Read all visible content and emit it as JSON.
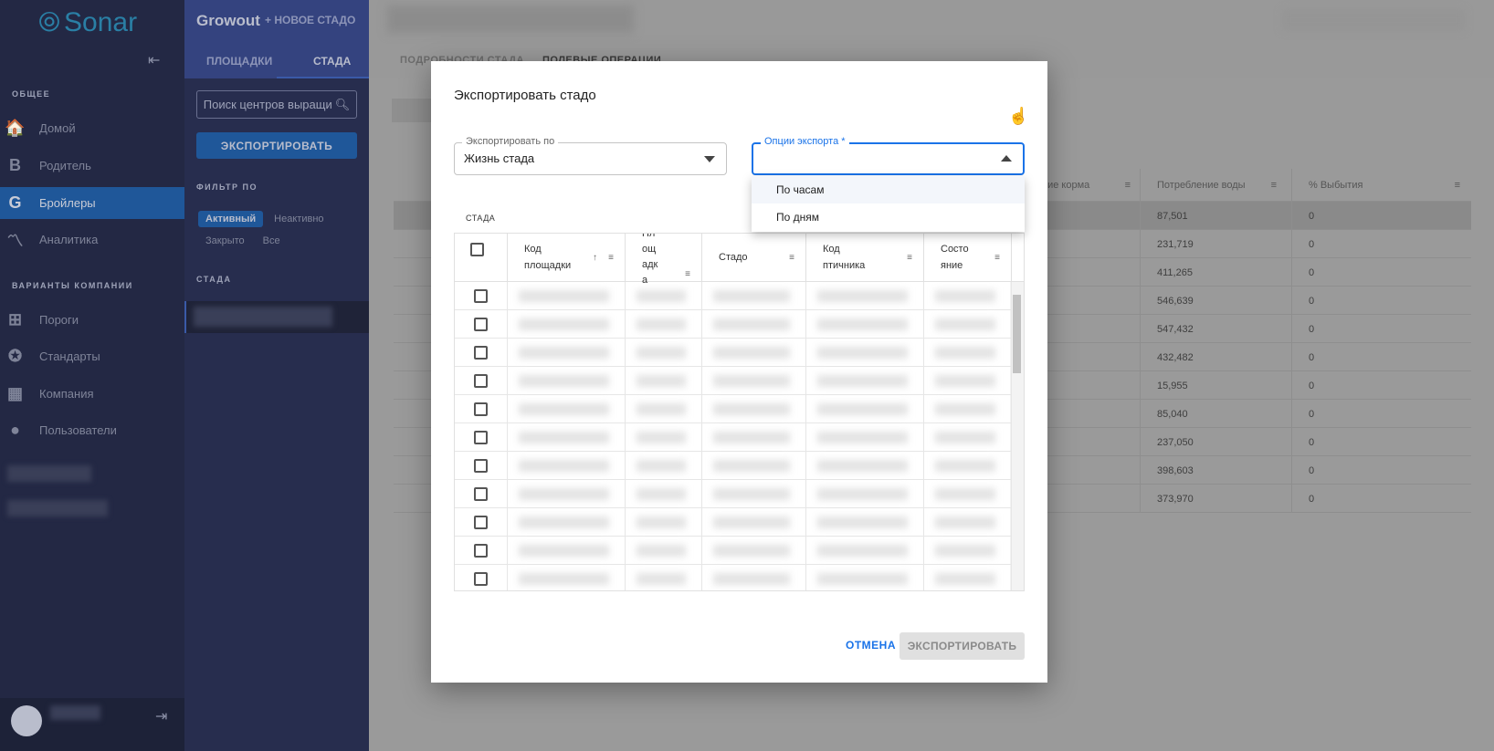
{
  "sidebar": {
    "logo": "Sonar",
    "section_general": "ОБЩЕЕ",
    "items": [
      {
        "label": "Домой",
        "icon": "🏠"
      },
      {
        "label": "Родитель",
        "icon": "B"
      },
      {
        "label": "Бройлеры",
        "icon": "G"
      },
      {
        "label": "Аналитика",
        "icon": "〽"
      }
    ],
    "section_company": "ВАРИАНТЫ КОМПАНИИ",
    "company_items": [
      {
        "label": "Пороги",
        "icon": "⊞"
      },
      {
        "label": "Стандарты",
        "icon": "✪"
      },
      {
        "label": "Компания",
        "icon": "▦"
      },
      {
        "label": "Пользователи",
        "icon": "●"
      }
    ]
  },
  "panel": {
    "title": "Growout",
    "new_herd": "+ НОВОЕ СТАДО",
    "tabs": [
      "ПЛОЩАДКИ",
      "СТАДА"
    ],
    "search_placeholder": "Поиск центров выращи",
    "export": "ЭКСПОРТИРОВАТЬ",
    "filter_label": "ФИЛЬТР ПО",
    "filters": [
      "Активный",
      "Неактивно",
      "Закрыто",
      "Все"
    ],
    "herds_label": "СТАДА"
  },
  "main": {
    "tabs": [
      "ПОДРОБНОСТИ СТАДА",
      "ПОЛЕВЫЕ ОПЕРАЦИИ"
    ],
    "columns": [
      "ние корма",
      "Потребление воды",
      "% Выбытия"
    ],
    "rows": [
      [
        "87,501",
        "0"
      ],
      [
        "231,719",
        "0"
      ],
      [
        "411,265",
        "0"
      ],
      [
        "546,639",
        "0"
      ],
      [
        "547,432",
        "0"
      ],
      [
        "432,482",
        "0"
      ],
      [
        "15,955",
        "0"
      ],
      [
        "85,040",
        "0"
      ],
      [
        "237,050",
        "0"
      ],
      [
        "398,603",
        "0"
      ],
      [
        "373,970",
        "0"
      ]
    ]
  },
  "modal": {
    "title": "Экспортировать стадо",
    "export_by_label": "Экспортировать по",
    "export_by_value": "Жизнь стада",
    "options_label": "Опции экспорта *",
    "options": [
      "По часам",
      "По дням"
    ],
    "herds_label": "СТАДА",
    "columns": [
      "Код площадки",
      "Пл ощ адк а",
      "Стадо",
      "Код птичника",
      "Состо яние"
    ],
    "cancel": "ОТМЕНА",
    "export": "ЭКСПОРТИРОВАТЬ"
  },
  "colors": {
    "accent": "#1a73e8",
    "sidebar_active": "#1f5799"
  }
}
